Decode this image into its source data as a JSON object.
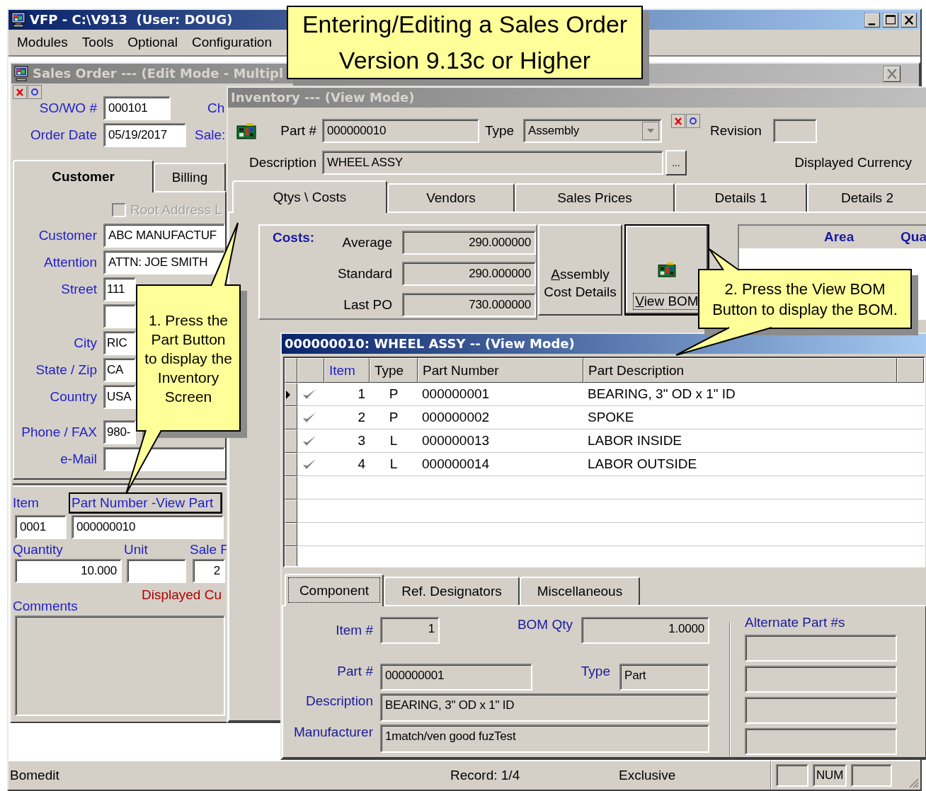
{
  "app": {
    "title": "VFP - C:\\V913  (User: DOUG)",
    "active": true,
    "menu": [
      "Modules",
      "Tools",
      "Optional",
      "Configuration"
    ]
  },
  "sales_order": {
    "title": "Sales Order --- (Edit Mode - Multipl",
    "active": false,
    "so_number": {
      "label": "SO/WO #",
      "value": "000101"
    },
    "order_date": {
      "label": "Order Date",
      "value": "05/19/2017"
    },
    "side_labels": [
      "Ch",
      "Sale:"
    ],
    "tabs": [
      {
        "label": "Customer",
        "selected": true
      },
      {
        "label": "Billing",
        "selected": false
      }
    ],
    "root_address": {
      "label": "Root Address L",
      "checked": false,
      "disabled": true
    },
    "fields": [
      {
        "kind": "field",
        "label": "Customer",
        "value": "ABC MANUFACTUF",
        "covered": false
      },
      {
        "kind": "field",
        "label": "Attention",
        "value": "ATTN: JOE SMITH",
        "covered": false
      },
      {
        "kind": "field",
        "label": "Street",
        "value": "111",
        "covered": true
      },
      {
        "kind": "blank_line",
        "covered": true
      },
      {
        "kind": "field",
        "label": "City",
        "value": "RIC",
        "covered": true
      },
      {
        "kind": "field",
        "label": "State / Zip",
        "value": "CA",
        "covered": true
      },
      {
        "kind": "field",
        "label": "Country",
        "value": "USA",
        "covered": true
      },
      {
        "kind": "spaced_field",
        "label": "Phone / FAX",
        "value": "980-",
        "covered": true
      },
      {
        "kind": "field",
        "label": "e-Mail",
        "covered": false
      }
    ],
    "line_item": {
      "item_label": "Item",
      "part_button": "Part Number -View Part",
      "item_value": "0001",
      "part_value": "000000010",
      "quantity_label": "Quantity",
      "unit_label": "Unit",
      "sale_label": "Sale F",
      "quantity_value": "10.000",
      "sale_value": "2"
    },
    "displayed_currency": "Displayed Cu",
    "comments_label": "Comments"
  },
  "inventory": {
    "title": "Inventory --- (View Mode)",
    "active": false,
    "part": {
      "label": "Part #",
      "value": "000000010"
    },
    "type": {
      "label": "Type",
      "value": "Assembly"
    },
    "revision": {
      "label": "Revision"
    },
    "description": {
      "label": "Description",
      "value": "WHEEL ASSY"
    },
    "lookup_button": "...",
    "displayed_currency": "Displayed Currency",
    "tabs": [
      {
        "label": "Qtys \\ Costs",
        "selected": true
      },
      {
        "label": "Vendors",
        "selected": false
      },
      {
        "label": "Sales Prices",
        "selected": false
      },
      {
        "label": "Details 1",
        "selected": false
      },
      {
        "label": "Details 2",
        "selected": false
      }
    ],
    "costs": {
      "heading": "Costs:",
      "rows": [
        {
          "label": "Average",
          "value": "290.000000"
        },
        {
          "label": "Standard",
          "value": "290.000000"
        },
        {
          "label": "Last PO",
          "value": "730.000000"
        }
      ]
    },
    "assembly_button": "Assembly Cost Details",
    "view_bom_button": "View BOM",
    "locations": {
      "columns": [
        "Area",
        "Qua"
      ]
    }
  },
  "bom": {
    "title": "000000010: WHEEL ASSY -- (View Mode)",
    "active": true,
    "columns": [
      {
        "label": "Item",
        "sorted": true
      },
      {
        "label": "Type",
        "sorted": false
      },
      {
        "label": "Part Number",
        "sorted": false
      },
      {
        "label": "Part Description",
        "sorted": false
      }
    ],
    "rows": [
      {
        "item": "1",
        "type": "P",
        "part_number": "000000001",
        "description": "BEARING, 3\" OD x 1\" ID",
        "selected": true,
        "checked": true
      },
      {
        "item": "2",
        "type": "P",
        "part_number": "000000002",
        "description": "SPOKE",
        "selected": false,
        "checked": true
      },
      {
        "item": "3",
        "type": "L",
        "part_number": "000000013",
        "description": "LABOR INSIDE",
        "selected": false,
        "checked": true
      },
      {
        "item": "4",
        "type": "L",
        "part_number": "000000014",
        "description": "LABOR OUTSIDE",
        "selected": false,
        "checked": true
      }
    ],
    "tabs": [
      {
        "label": "Component",
        "selected": true
      },
      {
        "label": "Ref. Designators",
        "selected": false
      },
      {
        "label": "Miscellaneous",
        "selected": false
      }
    ],
    "component": {
      "item_no": {
        "label": "Item #",
        "value": "1"
      },
      "bom_qty": {
        "label": "BOM Qty",
        "value": "1.0000"
      },
      "part_no": {
        "label": "Part #",
        "value": "000000001"
      },
      "type": {
        "label": "Type",
        "value": "Part"
      },
      "description": {
        "label": "Description",
        "value": "BEARING, 3\" OD x 1\" ID"
      },
      "manufacturer": {
        "label": "Manufacturer",
        "value": "1match/ven good fuzTest"
      },
      "alternates_label": "Alternate Part #s"
    }
  },
  "status_bar": {
    "message": "Bomedit",
    "record": "Record: 1/4",
    "mode": "Exclusive",
    "indicators": [
      "NUM"
    ]
  },
  "callouts": [
    {
      "kind": "banner",
      "lines": [
        "Entering/Editing a Sales Order",
        "Version 9.13c or Higher"
      ]
    },
    {
      "kind": "step",
      "text": "1. Press the Part Button to display the Inventory Screen"
    },
    {
      "kind": "step",
      "text": "2. Press the View BOM Button to display the BOM."
    }
  ]
}
